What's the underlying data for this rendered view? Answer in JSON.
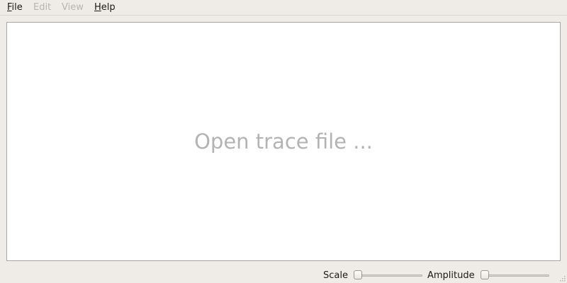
{
  "menubar": {
    "items": [
      {
        "mnemonic": "F",
        "rest": "ile",
        "enabled": true
      },
      {
        "mnemonic": "E",
        "rest": "dit",
        "enabled": false
      },
      {
        "mnemonic": "V",
        "rest": "iew",
        "enabled": false
      },
      {
        "mnemonic": "H",
        "rest": "elp",
        "enabled": true
      }
    ]
  },
  "canvas": {
    "placeholder": "Open trace file ..."
  },
  "controls": {
    "scale": {
      "label": "Scale",
      "value": 0
    },
    "amplitude": {
      "label": "Amplitude",
      "value": 0
    }
  },
  "icons": {
    "resize_grip": "resize-grip-icon"
  },
  "colors": {
    "window_bg": "#efebe7",
    "canvas_bg": "#ffffff",
    "placeholder_text": "#b3b3b3",
    "disabled_text": "#b8b4af"
  }
}
